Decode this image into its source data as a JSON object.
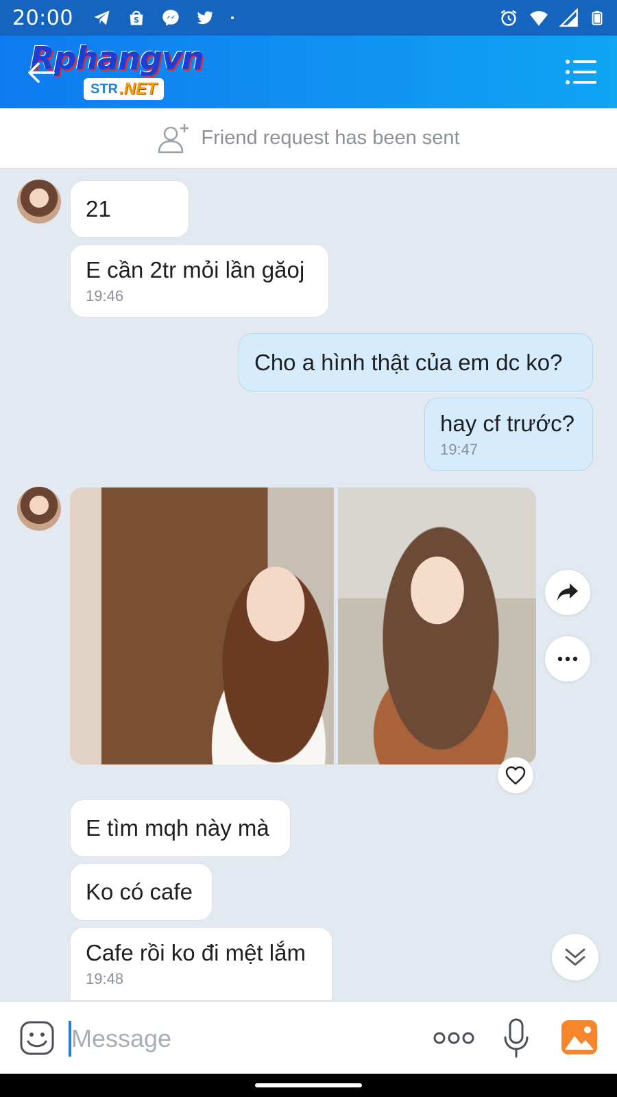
{
  "status_bar": {
    "time": "20:00",
    "left_icons": [
      "telegram-icon",
      "shopee-icon",
      "messenger-icon",
      "twitter-icon",
      "dot-icon"
    ],
    "right_icons": [
      "alarm-icon",
      "wifi-icon",
      "signal-icon",
      "battery-icon"
    ],
    "bg_color": "#1565c0"
  },
  "header": {
    "logo_text": "Rphangvn",
    "logo_badge_left": "STR",
    "logo_badge_right": ".NET",
    "back_icon": "back-arrow-icon",
    "menu_icon": "menu-list-icon",
    "gradient": [
      "#0f7bf0",
      "#10a4f3"
    ]
  },
  "friend_request": {
    "icon": "add-friend-icon",
    "text": "Friend request has been sent"
  },
  "messages": [
    {
      "direction": "in",
      "text": "21",
      "time": ""
    },
    {
      "direction": "in",
      "text": "E cần 2tr mỏi lần găoj",
      "time": "19:46"
    },
    {
      "direction": "out",
      "text": "Cho a hình thật của em dc ko?",
      "time": ""
    },
    {
      "direction": "out",
      "text": "hay cf trước?",
      "time": "19:47"
    },
    {
      "direction": "in",
      "type": "photos",
      "count": 2
    },
    {
      "direction": "in",
      "text": "E tìm mqh này mà",
      "time": ""
    },
    {
      "direction": "in",
      "text": "Ko có cafe",
      "time": ""
    },
    {
      "direction": "in",
      "text": "Cafe rồi ko đi mệt lắm",
      "time": "19:48"
    }
  ],
  "photo_actions": {
    "share_icon": "share-arrow-icon",
    "more_icon": "more-dots-icon",
    "react_icon": "heart-icon"
  },
  "scroll_down_icon": "double-chevron-down-icon",
  "input_bar": {
    "placeholder": "Message",
    "value": "",
    "emoji_icon": "sticker-emoji-icon",
    "more_icon": "more-options-icon",
    "mic_icon": "microphone-icon",
    "image_icon": "gallery-icon",
    "accent_color": "#f7852b"
  },
  "colors": {
    "chat_bg": "#e2e9f1",
    "incoming_bubble": "#ffffff",
    "outgoing_bubble": "#d6ecfc",
    "caret": "#1e7ce8"
  }
}
